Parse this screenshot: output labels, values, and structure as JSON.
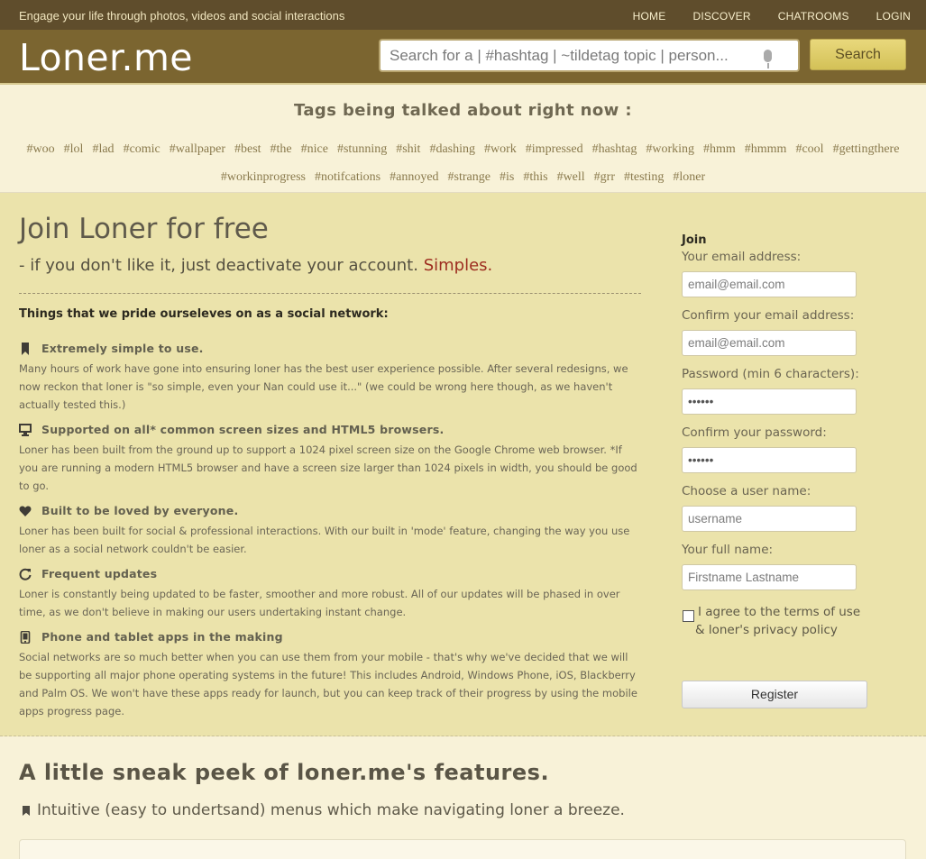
{
  "topbar": {
    "tagline": "Engage your life through photos, videos and social interactions",
    "nav": [
      "HOME",
      "DISCOVER",
      "CHATROOMS",
      "LOGIN"
    ]
  },
  "header": {
    "logo": "Loner.me",
    "search_placeholder": "Search for a | #hashtag | ~tildetag topic | person...",
    "search_button": "Search"
  },
  "tags": {
    "title": "Tags being talked about right now :",
    "items": [
      "#woo",
      "#lol",
      "#lad",
      "#comic",
      "#wallpaper",
      "#best",
      "#the",
      "#nice",
      "#stunning",
      "#shit",
      "#dashing",
      "#work",
      "#impressed",
      "#hashtag",
      "#working",
      "#hmm",
      "#hmmm",
      "#cool",
      "#gettingthere",
      "#workinprogress",
      "#notifcations",
      "#annoyed",
      "#strange",
      "#is",
      "#this",
      "#well",
      "#grr",
      "#testing",
      "#loner"
    ]
  },
  "join": {
    "title": "Join Loner for free",
    "subtitle_prefix": "- if you don't like it, just deactivate your account.",
    "subtitle_highlight": "Simples.",
    "pride_heading": "Things that we pride ourseleves on as a social network:",
    "features": [
      {
        "icon": "bookmark-icon",
        "title": "Extremely simple to use.",
        "text": "Many hours of work have gone into ensuring loner has the best user experience possible. After several redesigns, we now reckon that loner is \"so simple, even your Nan could use it...\" (we could be wrong here though, as we haven't actually tested this.)"
      },
      {
        "icon": "monitor-icon",
        "title": "Supported on all* common screen sizes and HTML5 browsers.",
        "text": "Loner has been built from the ground up to support a 1024 pixel screen size on the Google Chrome web browser. *If you are running a modern HTML5 browser and have a screen size larger than 1024 pixels in width, you should be good to go."
      },
      {
        "icon": "heart-icon",
        "title": "Built to be loved by everyone.",
        "text": "Loner has been built for social & professional interactions. With our built in 'mode' feature, changing the way you use loner as a social network couldn't be easier."
      },
      {
        "icon": "refresh-icon",
        "title": "Frequent updates",
        "text": "Loner is constantly being updated to be faster, smoother and more robust. All of our updates will be phased in over time, as we don't believe in making our users undertaking instant change."
      },
      {
        "icon": "phone-icon",
        "title": "Phone and tablet apps in the making",
        "text": "Social networks are so much better when you can use them from your mobile - that's why we've decided that we will be supporting all major phone operating systems in the future! This includes Android, Windows Phone, iOS, Blackberry and Palm OS. We won't have these apps ready for launch, but you can keep track of their progress by using the mobile apps progress page."
      }
    ]
  },
  "form": {
    "title": "Join",
    "email_label": "Your email address:",
    "email_placeholder": "email@email.com",
    "confirm_email_label": "Confirm your email address:",
    "confirm_email_placeholder": "email@email.com",
    "password_label": "Password (min 6 characters):",
    "password_value": "••••••",
    "confirm_password_label": "Confirm your password:",
    "confirm_password_value": "••••••",
    "username_label": "Choose a user name:",
    "username_placeholder": "username",
    "fullname_label": "Your full name:",
    "fullname_placeholder": "Firstname Lastname",
    "agree_text": "I agree to the terms of use & loner's privacy policy",
    "register_button": "Register"
  },
  "peek": {
    "title": "A little sneak peek of loner.me's features.",
    "subtitle": "Intuitive (easy to undertsand) menus which make navigating loner a breeze."
  }
}
